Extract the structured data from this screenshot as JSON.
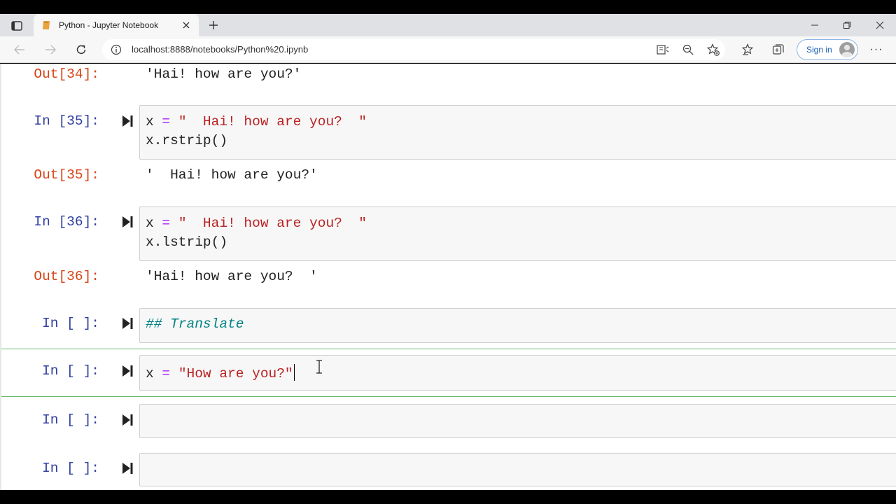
{
  "browser": {
    "tab_title": "Python - Jupyter Notebook",
    "url": "localhost:8888/notebooks/Python%20.ipynb",
    "sign_in_label": "Sign in",
    "menu_label": "···"
  },
  "notebook": {
    "cells": [
      {
        "id": "out34",
        "out_prompt": "Out[34]:",
        "output": "'Hai! how are you?'"
      },
      {
        "id": "c35",
        "in_prompt": "In [35]:",
        "code": {
          "line1": {
            "var": "x",
            "op": "=",
            "str": "\"  Hai! how are you?  \""
          },
          "line2": "x.rstrip()"
        },
        "out_prompt": "Out[35]:",
        "output": "'  Hai! how are you?'"
      },
      {
        "id": "c36",
        "in_prompt": "In [36]:",
        "code": {
          "line1": {
            "var": "x",
            "op": "=",
            "str": "\"  Hai! how are you?  \""
          },
          "line2": "x.lstrip()"
        },
        "out_prompt": "Out[36]:",
        "output": "'Hai! how are you?  '"
      },
      {
        "id": "c37",
        "in_prompt": "In [ ]:",
        "code": {
          "line1": "## Translate"
        }
      },
      {
        "id": "c38",
        "in_prompt": "In [ ]:",
        "code": {
          "line1": {
            "var": "x",
            "op": "=",
            "str": "\"How are you?\""
          }
        }
      },
      {
        "id": "c39",
        "in_prompt": "In [ ]:"
      },
      {
        "id": "c40",
        "in_prompt": "In [ ]:"
      }
    ]
  }
}
